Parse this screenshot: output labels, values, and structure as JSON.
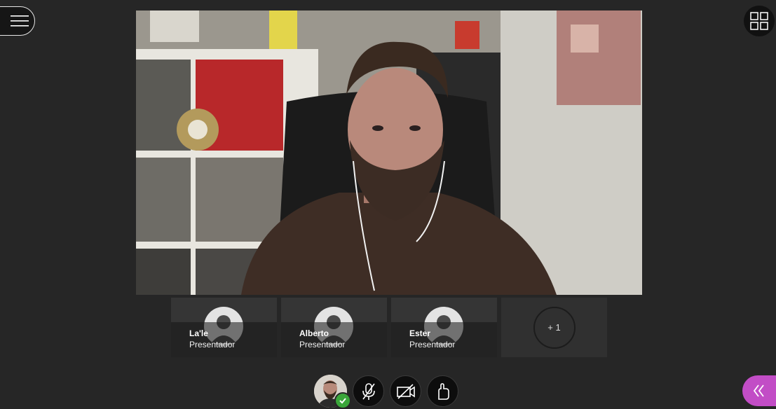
{
  "header": {
    "menu_icon": "hamburger-icon",
    "layout_icon": "grid-layout-icon"
  },
  "main_video": {
    "description_icon": "video-feed"
  },
  "participants": [
    {
      "name": "La'le",
      "role": "Presentador"
    },
    {
      "name": "Alberto",
      "role": "Presentador"
    },
    {
      "name": "Ester",
      "role": "Presentador"
    }
  ],
  "more_participants": {
    "label": "+ 1"
  },
  "controls": {
    "avatar_status_icon": "check-icon",
    "mic_icon": "microphone-off-icon",
    "camera_icon": "camera-off-icon",
    "share_icon": "raise-hand-icon"
  },
  "side_panel": {
    "toggle_icon": "double-chevron-left-icon"
  },
  "colors": {
    "background": "#262626",
    "accent_panel": "#c24dc6",
    "status_ok": "#3aa63a"
  }
}
